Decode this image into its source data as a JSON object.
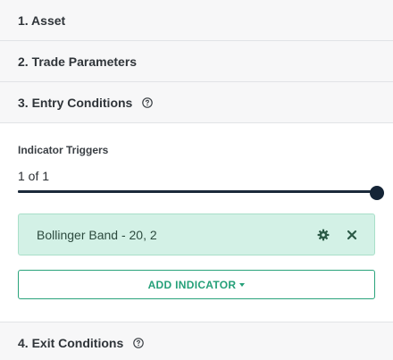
{
  "sections": {
    "asset": {
      "title": "1. Asset"
    },
    "trade": {
      "title": "2. Trade Parameters"
    },
    "entry": {
      "title": "3. Entry Conditions"
    },
    "exit": {
      "title": "4. Exit Conditions"
    }
  },
  "entry": {
    "triggers_label": "Indicator Triggers",
    "count_label": "1 of 1",
    "slider_value": 1,
    "slider_max": 1,
    "indicator": {
      "name": "Bollinger Band - 20, 2",
      "settings_icon": "gear-icon",
      "remove_icon": "close-icon"
    },
    "add_button_label": "ADD INDICATOR"
  },
  "colors": {
    "accent": "#25a079",
    "card_bg": "#d3f1e6",
    "slider": "#142436",
    "header_bg": "#f7f7f8"
  }
}
